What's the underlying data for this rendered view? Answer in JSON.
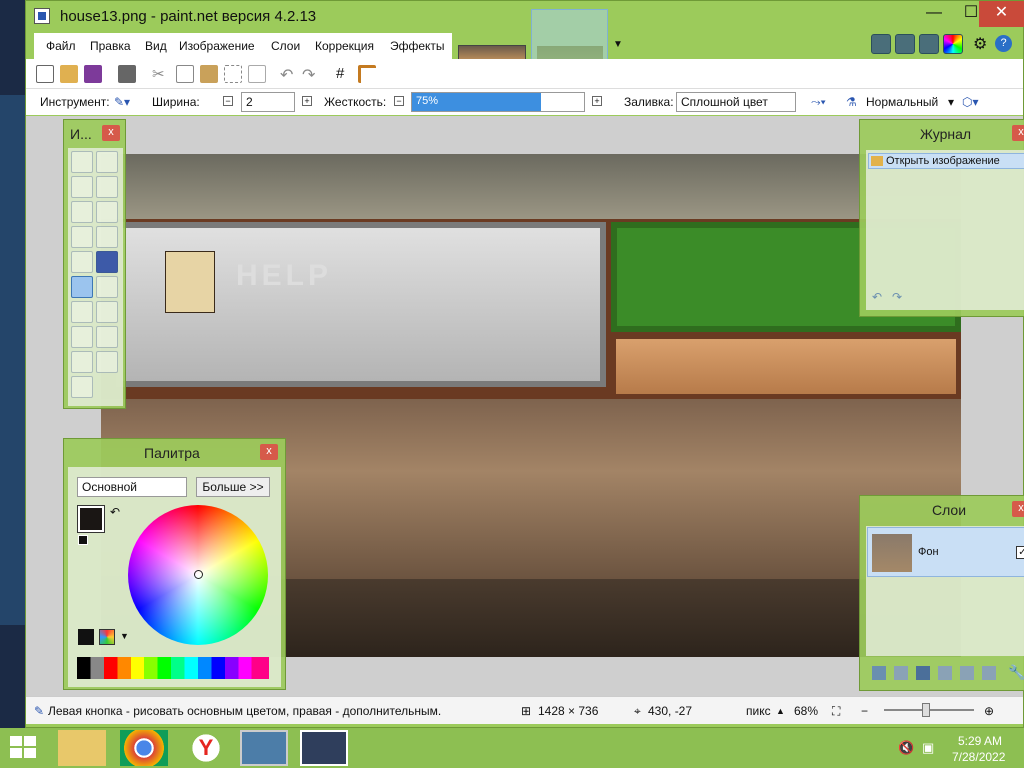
{
  "window": {
    "title": "house13.png - paint.net версия 4.2.13",
    "minimize": "—",
    "maximize": "☐",
    "close": "✕"
  },
  "menu": [
    "Файл",
    "Правка",
    "Вид",
    "Изображение",
    "Слои",
    "Коррекция",
    "Эффекты"
  ],
  "options": {
    "tool_label": "Инструмент:",
    "width_label": "Ширина:",
    "width_value": "2",
    "hardness_label": "Жесткость:",
    "hardness_value": "75%",
    "hardness_level": 0.75,
    "fill_label": "Заливка:",
    "fill_value": "Сплошной цвет",
    "blend_value": "Нормальный"
  },
  "tools_panel": {
    "title": "И...",
    "close": "x"
  },
  "palette_panel": {
    "title": "Палитра",
    "close": "x",
    "mode": "Основной",
    "more_button": "Больше >>"
  },
  "history_panel": {
    "title": "Журнал",
    "close": "x",
    "items": [
      "Открыть изображение"
    ]
  },
  "layers_panel": {
    "title": "Слои",
    "close": "x",
    "layers": [
      "Фон"
    ]
  },
  "canvas": {
    "help_text": "HELP"
  },
  "status": {
    "hint": "Левая кнопка - рисовать основным цветом, правая - дополнительным.",
    "image_size": "1428 × 736",
    "cursor_pos": "430, -27",
    "units": "пикс",
    "zoom": "68%"
  },
  "taskbar": {
    "time": "5:29 AM",
    "date": "7/28/2022"
  },
  "colors": {
    "chrome": "#9ccb5b",
    "accent": "#3d8fe0",
    "close": "#c94a3a"
  }
}
